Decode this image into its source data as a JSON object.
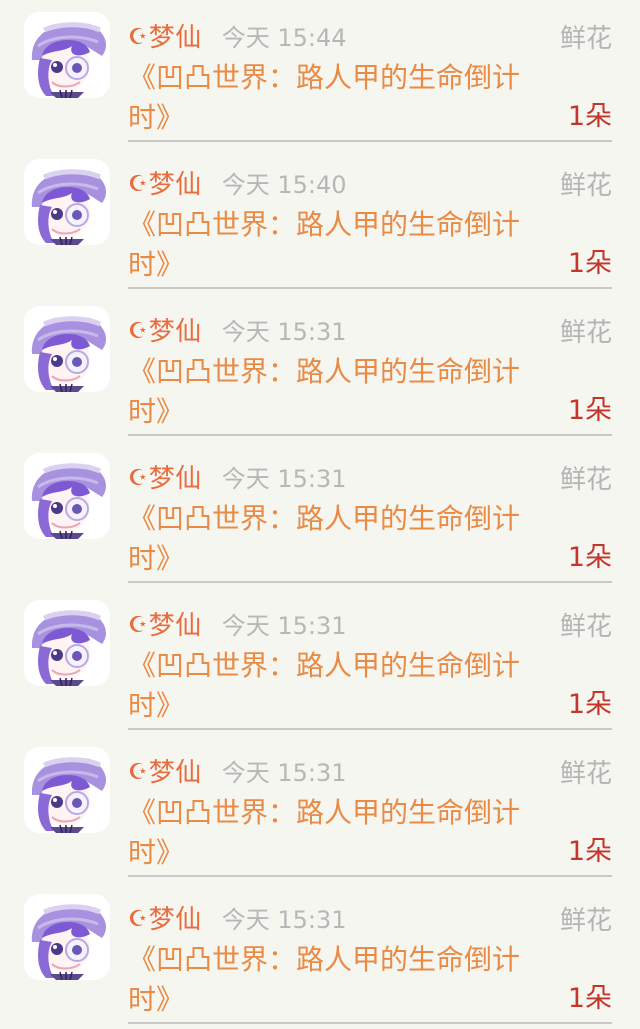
{
  "entries": [
    {
      "name": "梦仙",
      "time": "今天 15:44",
      "gift_type": "鲜花",
      "book_title": "《凹凸世界：路人甲的生命倒计时》",
      "count": "1朵"
    },
    {
      "name": "梦仙",
      "time": "今天 15:40",
      "gift_type": "鲜花",
      "book_title": "《凹凸世界：路人甲的生命倒计时》",
      "count": "1朵"
    },
    {
      "name": "梦仙",
      "time": "今天 15:31",
      "gift_type": "鲜花",
      "book_title": "《凹凸世界：路人甲的生命倒计时》",
      "count": "1朵"
    },
    {
      "name": "梦仙",
      "time": "今天 15:31",
      "gift_type": "鲜花",
      "book_title": "《凹凸世界：路人甲的生命倒计时》",
      "count": "1朵"
    },
    {
      "name": "梦仙",
      "time": "今天 15:31",
      "gift_type": "鲜花",
      "book_title": "《凹凸世界：路人甲的生命倒计时》",
      "count": "1朵"
    },
    {
      "name": "梦仙",
      "time": "今天 15:31",
      "gift_type": "鲜花",
      "book_title": "《凹凸世界：路人甲的生命倒计时》",
      "count": "1朵"
    },
    {
      "name": "梦仙",
      "time": "今天 15:31",
      "gift_type": "鲜花",
      "book_title": "《凹凸世界：路人甲的生命倒计时》",
      "count": "1朵"
    }
  ],
  "icons": {
    "avatar": "anime-avatar-icon",
    "moon": "crescent-moon-icon"
  },
  "colors": {
    "background": "#f6f6f1",
    "name": "#e96c3e",
    "book_title": "#e98a45",
    "time": "#b7b7b7",
    "gift_type": "#b4b4b4",
    "count": "#c4352a",
    "divider": "#c9c9c9"
  }
}
